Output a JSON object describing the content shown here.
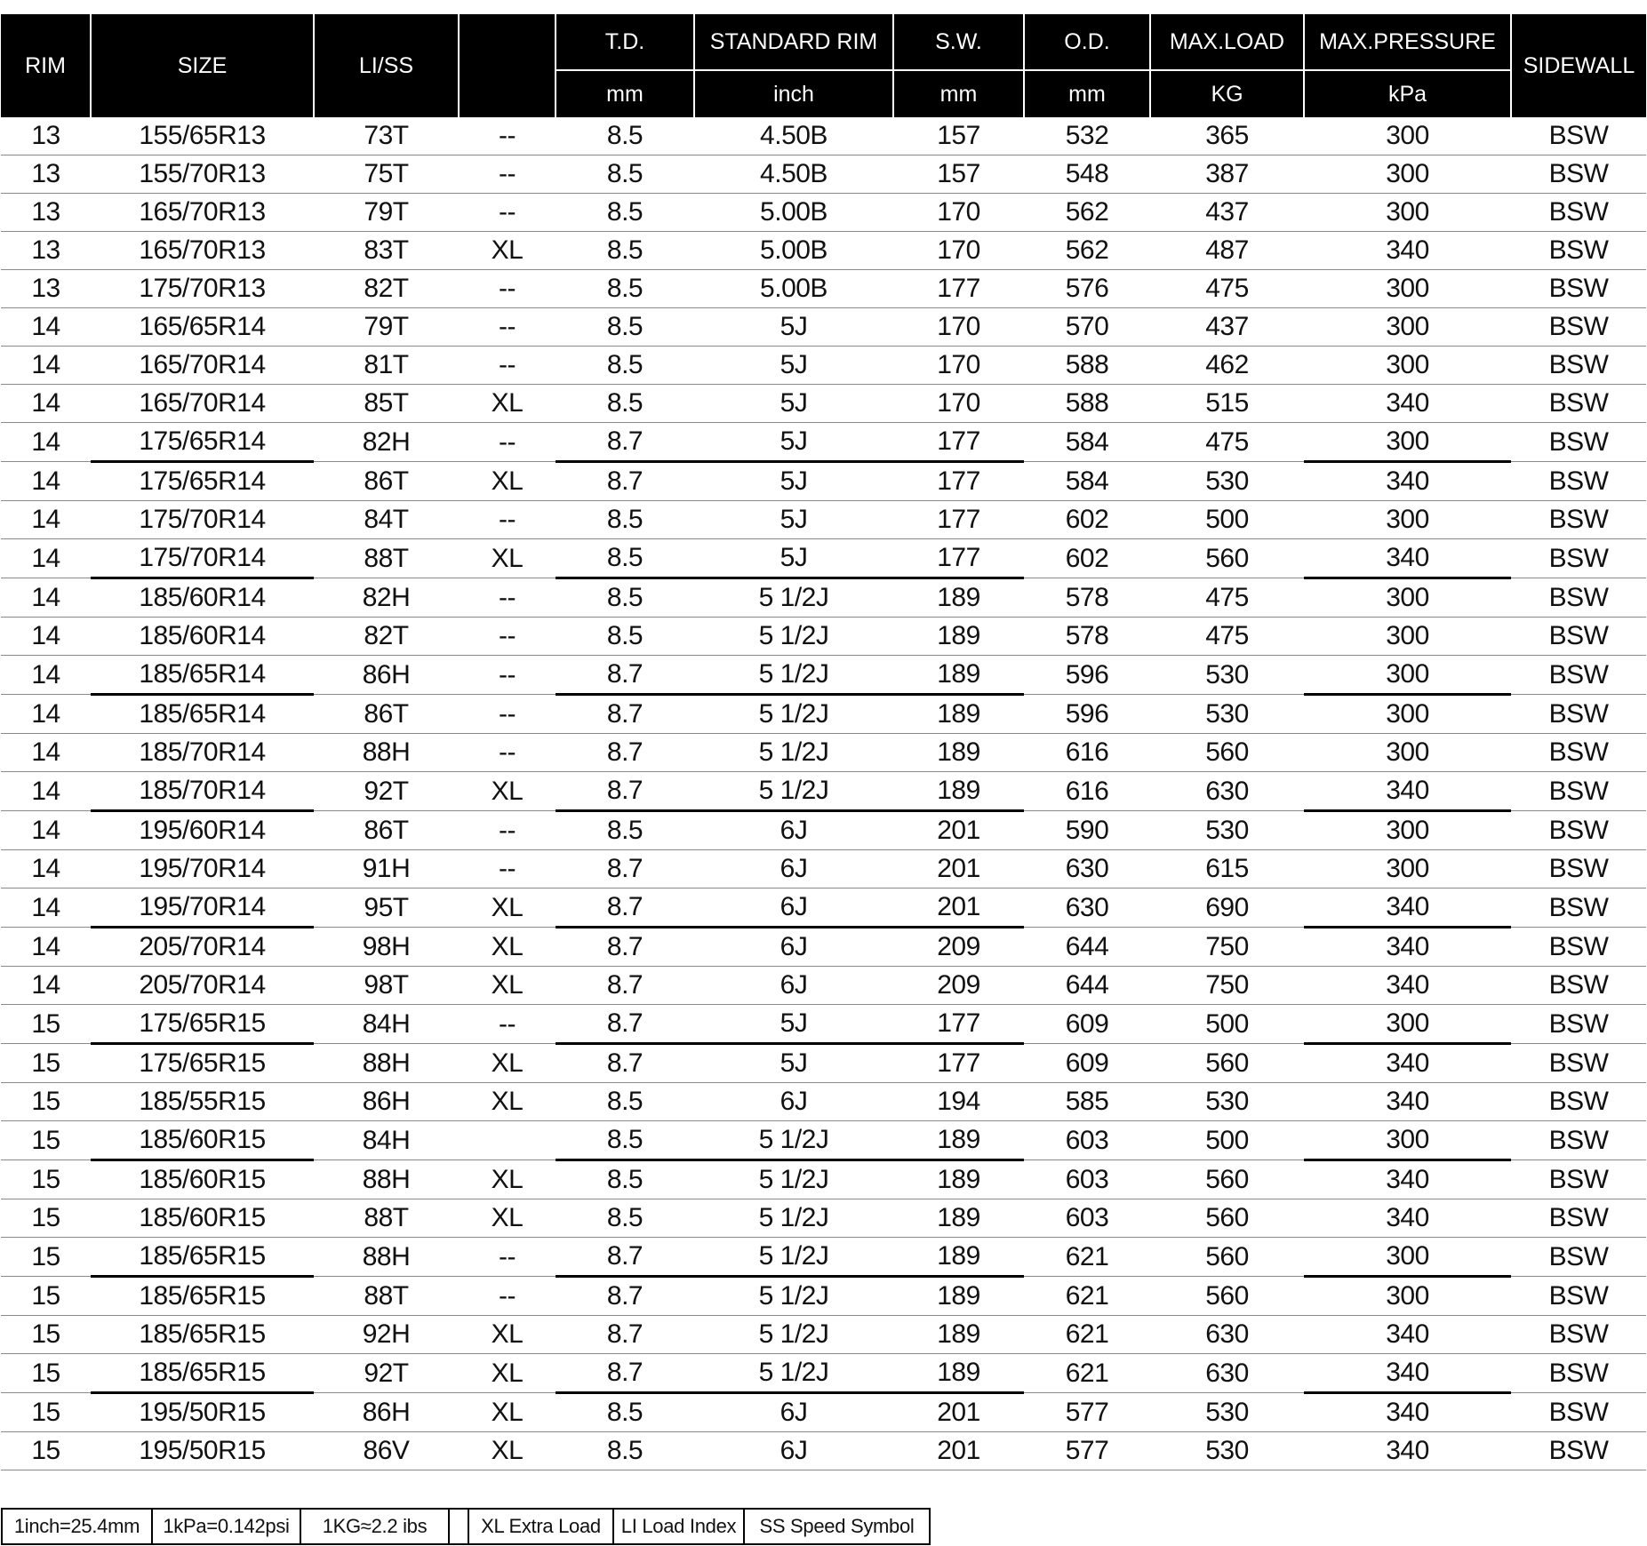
{
  "headers": {
    "rim": "RIM",
    "size": "SIZE",
    "liss": "LI/SS",
    "blank": "",
    "td": "T.D.",
    "std_rim": "STANDARD RIM",
    "sw": "S.W.",
    "od": "O.D.",
    "max_load": "MAX.LOAD",
    "max_pressure": "MAX.PRESSURE",
    "sidewall": "SIDEWALL",
    "td_unit": "mm",
    "std_rim_unit": "inch",
    "sw_unit": "mm",
    "od_unit": "mm",
    "max_load_unit": "KG",
    "max_pressure_unit": "kPa"
  },
  "rows": [
    [
      "13",
      "155/65R13",
      "73T",
      "--",
      "8.5",
      "4.50B",
      "157",
      "532",
      "365",
      "300",
      "BSW"
    ],
    [
      "13",
      "155/70R13",
      "75T",
      "--",
      "8.5",
      "4.50B",
      "157",
      "548",
      "387",
      "300",
      "BSW"
    ],
    [
      "13",
      "165/70R13",
      "79T",
      "--",
      "8.5",
      "5.00B",
      "170",
      "562",
      "437",
      "300",
      "BSW"
    ],
    [
      "13",
      "165/70R13",
      "83T",
      "XL",
      "8.5",
      "5.00B",
      "170",
      "562",
      "487",
      "340",
      "BSW"
    ],
    [
      "13",
      "175/70R13",
      "82T",
      "--",
      "8.5",
      "5.00B",
      "177",
      "576",
      "475",
      "300",
      "BSW"
    ],
    [
      "14",
      "165/65R14",
      "79T",
      "--",
      "8.5",
      "5J",
      "170",
      "570",
      "437",
      "300",
      "BSW"
    ],
    [
      "14",
      "165/70R14",
      "81T",
      "--",
      "8.5",
      "5J",
      "170",
      "588",
      "462",
      "300",
      "BSW"
    ],
    [
      "14",
      "165/70R14",
      "85T",
      "XL",
      "8.5",
      "5J",
      "170",
      "588",
      "515",
      "340",
      "BSW"
    ],
    [
      "14",
      "175/65R14",
      "82H",
      "--",
      "8.7",
      "5J",
      "177",
      "584",
      "475",
      "300",
      "BSW"
    ],
    [
      "14",
      "175/65R14",
      "86T",
      "XL",
      "8.7",
      "5J",
      "177",
      "584",
      "530",
      "340",
      "BSW"
    ],
    [
      "14",
      "175/70R14",
      "84T",
      "--",
      "8.5",
      "5J",
      "177",
      "602",
      "500",
      "300",
      "BSW"
    ],
    [
      "14",
      "175/70R14",
      "88T",
      "XL",
      "8.5",
      "5J",
      "177",
      "602",
      "560",
      "340",
      "BSW"
    ],
    [
      "14",
      "185/60R14",
      "82H",
      "--",
      "8.5",
      "5 1/2J",
      "189",
      "578",
      "475",
      "300",
      "BSW"
    ],
    [
      "14",
      "185/60R14",
      "82T",
      "--",
      "8.5",
      "5 1/2J",
      "189",
      "578",
      "475",
      "300",
      "BSW"
    ],
    [
      "14",
      "185/65R14",
      "86H",
      "--",
      "8.7",
      "5 1/2J",
      "189",
      "596",
      "530",
      "300",
      "BSW"
    ],
    [
      "14",
      "185/65R14",
      "86T",
      "--",
      "8.7",
      "5 1/2J",
      "189",
      "596",
      "530",
      "300",
      "BSW"
    ],
    [
      "14",
      "185/70R14",
      "88H",
      "--",
      "8.7",
      "5 1/2J",
      "189",
      "616",
      "560",
      "300",
      "BSW"
    ],
    [
      "14",
      "185/70R14",
      "92T",
      "XL",
      "8.7",
      "5 1/2J",
      "189",
      "616",
      "630",
      "340",
      "BSW"
    ],
    [
      "14",
      "195/60R14",
      "86T",
      "--",
      "8.5",
      "6J",
      "201",
      "590",
      "530",
      "300",
      "BSW"
    ],
    [
      "14",
      "195/70R14",
      "91H",
      "--",
      "8.7",
      "6J",
      "201",
      "630",
      "615",
      "300",
      "BSW"
    ],
    [
      "14",
      "195/70R14",
      "95T",
      "XL",
      "8.7",
      "6J",
      "201",
      "630",
      "690",
      "340",
      "BSW"
    ],
    [
      "14",
      "205/70R14",
      "98H",
      "XL",
      "8.7",
      "6J",
      "209",
      "644",
      "750",
      "340",
      "BSW"
    ],
    [
      "14",
      "205/70R14",
      "98T",
      "XL",
      "8.7",
      "6J",
      "209",
      "644",
      "750",
      "340",
      "BSW"
    ],
    [
      "15",
      "175/65R15",
      "84H",
      "--",
      "8.7",
      "5J",
      "177",
      "609",
      "500",
      "300",
      "BSW"
    ],
    [
      "15",
      "175/65R15",
      "88H",
      "XL",
      "8.7",
      "5J",
      "177",
      "609",
      "560",
      "340",
      "BSW"
    ],
    [
      "15",
      "185/55R15",
      "86H",
      "XL",
      "8.5",
      "6J",
      "194",
      "585",
      "530",
      "340",
      "BSW"
    ],
    [
      "15",
      "185/60R15",
      "84H",
      "",
      "8.5",
      "5 1/2J",
      "189",
      "603",
      "500",
      "300",
      "BSW"
    ],
    [
      "15",
      "185/60R15",
      "88H",
      "XL",
      "8.5",
      "5 1/2J",
      "189",
      "603",
      "560",
      "340",
      "BSW"
    ],
    [
      "15",
      "185/60R15",
      "88T",
      "XL",
      "8.5",
      "5 1/2J",
      "189",
      "603",
      "560",
      "340",
      "BSW"
    ],
    [
      "15",
      "185/65R15",
      "88H",
      "--",
      "8.7",
      "5 1/2J",
      "189",
      "621",
      "560",
      "300",
      "BSW"
    ],
    [
      "15",
      "185/65R15",
      "88T",
      "--",
      "8.7",
      "5 1/2J",
      "189",
      "621",
      "560",
      "300",
      "BSW"
    ],
    [
      "15",
      "185/65R15",
      "92H",
      "XL",
      "8.7",
      "5 1/2J",
      "189",
      "621",
      "630",
      "340",
      "BSW"
    ],
    [
      "15",
      "185/65R15",
      "92T",
      "XL",
      "8.7",
      "5 1/2J",
      "189",
      "621",
      "630",
      "340",
      "BSW"
    ],
    [
      "15",
      "195/50R15",
      "86H",
      "XL",
      "8.5",
      "6J",
      "201",
      "577",
      "530",
      "340",
      "BSW"
    ],
    [
      "15",
      "195/50R15",
      "86V",
      "XL",
      "8.5",
      "6J",
      "201",
      "577",
      "530",
      "340",
      "BSW"
    ]
  ],
  "thick_after_rows": [
    8,
    11,
    14,
    17,
    20,
    23,
    26,
    29,
    32
  ],
  "footer": [
    "1inch=25.4mm",
    "1kPa=0.142psi",
    "1KG≈2.2 ibs",
    "",
    "XL Extra Load",
    "LI  Load Index",
    "SS  Speed Symbol"
  ]
}
